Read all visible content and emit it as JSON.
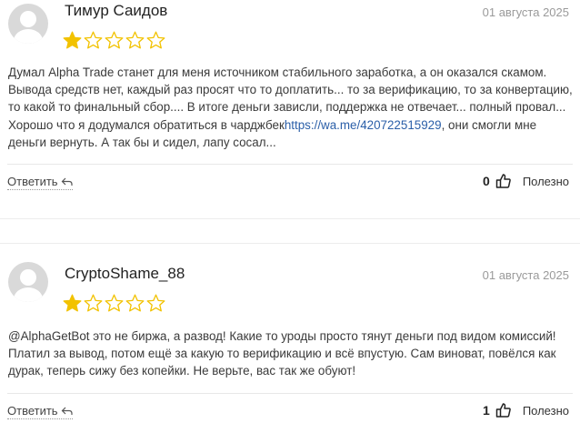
{
  "reviews": [
    {
      "author": "Тимур Саидов",
      "date": "01 августа 2025",
      "rating": 1,
      "rating_max": 5,
      "text_before_link": "Думал Alpha Trade станет для меня источником стабильного заработка, а он оказался скамом. Вывода средств нет, каждый раз просят что то доплатить... то за верификацию, то за конвертацию, то какой то финальный сбор.... В итоге деньги зависли, поддержка не отвечает... полный провал... Хорошо что я додумался обратиться в чарджбек",
      "link": "https://wa.me/420722515929",
      "text_after_link": ", они смогли мне деньги вернуть. А так бы и сидел, лапу сосал...",
      "reply_label": "Ответить",
      "likes": "0",
      "useful_label": "Полезно"
    },
    {
      "author": "CryptoShame_88",
      "date": "01 августа 2025",
      "rating": 1,
      "rating_max": 5,
      "text_before_link": "@AlphaGetBot это не биржа, а развод! Какие то уроды просто тянут деньги под видом комиссий! Платил за вывод, потом ещё за какую то верификацию и всё впустую. Сам виноват, повёлся как дурак, теперь сижу без копейки. Не верьте, вас так же обуют!",
      "link": "",
      "text_after_link": "",
      "reply_label": "Ответить",
      "likes": "1",
      "useful_label": "Полезно"
    }
  ],
  "colors": {
    "star_filled": "#f2c200",
    "star_empty_stroke": "#f2c200",
    "link": "#2b5fa8",
    "date": "#9a9a9a"
  },
  "icons": {
    "avatar": "user-placeholder-icon",
    "reply": "reply-arrow-icon",
    "like": "thumbs-up-icon",
    "star": "star-icon"
  }
}
